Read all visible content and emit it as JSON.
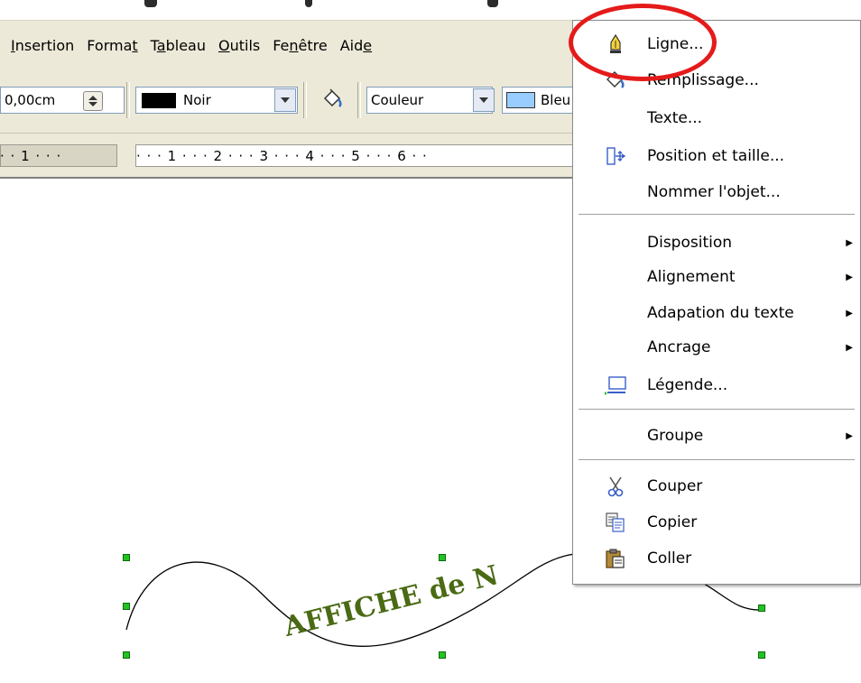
{
  "menubar": {
    "items": [
      {
        "label": "Insertion"
      },
      {
        "label": "Format"
      },
      {
        "label": "Tableau"
      },
      {
        "label": "Outils"
      },
      {
        "label": "Fenêtre"
      },
      {
        "label": "Aide"
      }
    ]
  },
  "toolbar": {
    "line_width": "0,00cm",
    "line_color": "Noir",
    "line_color_swatch": "#000000",
    "fill_type": "Couleur",
    "fill_color": "Bleu",
    "fill_color_swatch": "#99ccff"
  },
  "ruler": {
    "left_text": "· · 1 · · ·",
    "main_text": "· · · 1 · · · 2 · · · 3 · · · 4 · · · 5 · · · 6 · ·"
  },
  "canvas": {
    "text_art": "AFFICHE de N",
    "text_art_color": "#4a6a14"
  },
  "context_menu": {
    "items": [
      {
        "label": "Ligne...",
        "icon": "pen-line-icon"
      },
      {
        "label": "Remplissage...",
        "icon": "fill-bucket-icon"
      },
      {
        "label": "Texte..."
      },
      {
        "label": "Position et taille...",
        "icon": "position-size-icon"
      },
      {
        "label": "Nommer l'objet..."
      },
      {
        "label": "Disposition",
        "submenu": true
      },
      {
        "label": "Alignement",
        "submenu": true
      },
      {
        "label": "Adapation du texte",
        "submenu": true
      },
      {
        "label": "Ancrage",
        "submenu": true
      },
      {
        "label": "Légende...",
        "icon": "caption-icon"
      },
      {
        "label": "Groupe",
        "submenu": true
      },
      {
        "label": "Couper",
        "icon": "scissors-icon"
      },
      {
        "label": "Copier",
        "icon": "copy-icon"
      },
      {
        "label": "Coller",
        "icon": "paste-icon"
      }
    ]
  },
  "colors": {
    "highlight": "#e51a1a",
    "handle": "#22c322",
    "menubar_bg": "#ece9d8"
  }
}
